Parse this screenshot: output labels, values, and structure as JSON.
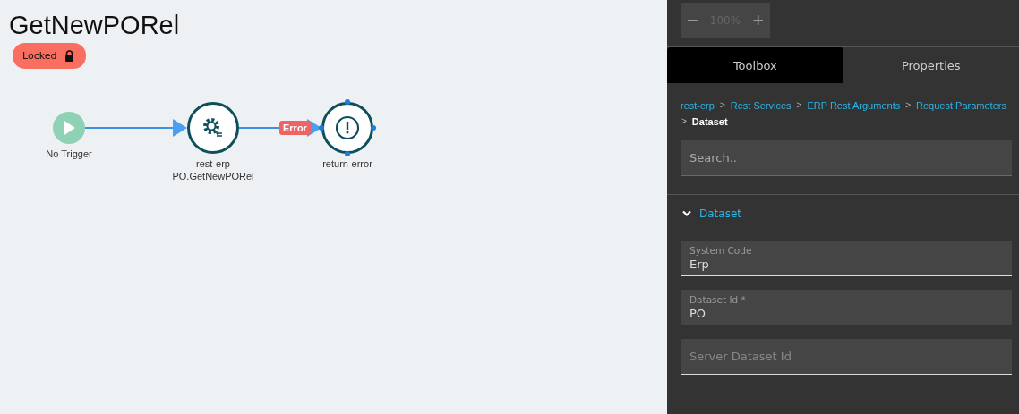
{
  "flow": {
    "title": "GetNewPORel",
    "status": {
      "label": "Locked",
      "locked": true
    }
  },
  "diagram": {
    "nodes": [
      {
        "kind": "trigger",
        "label": "No Trigger"
      },
      {
        "kind": "service",
        "label": "rest-erp",
        "sublabel": "PO.GetNewPORel"
      },
      {
        "kind": "error",
        "label": "return-error",
        "selected": true
      }
    ],
    "edges": [
      {
        "kind": "plain"
      },
      {
        "kind": "labeled",
        "label": "Error"
      }
    ]
  },
  "zoom": {
    "value": "100%",
    "minus": "−",
    "plus": "+"
  },
  "tabs": [
    {
      "label": "Toolbox",
      "selected": true
    },
    {
      "label": "Properties",
      "selected": false
    }
  ],
  "breadcrumb_separator": ">",
  "breadcrumb": [
    {
      "label": "rest-erp",
      "current": false
    },
    {
      "label": "Rest Services",
      "current": false
    },
    {
      "label": "ERP Rest Arguments",
      "current": false
    },
    {
      "label": "Request Parameters",
      "current": false
    },
    {
      "label": "Dataset",
      "current": true
    }
  ],
  "search": {
    "placeholder": "Search.."
  },
  "section": {
    "title": "Dataset",
    "expanded": true,
    "fields": [
      {
        "label": "System Code",
        "value": "Erp"
      },
      {
        "label": "Dataset Id *",
        "value": "PO"
      },
      {
        "placeholder": "Server Dataset Id"
      }
    ]
  }
}
